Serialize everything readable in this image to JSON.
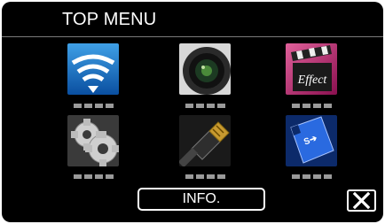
{
  "header": {
    "title": "TOP MENU"
  },
  "menu_items": [
    {
      "icon": "wifi-icon"
    },
    {
      "icon": "camera-lens-icon"
    },
    {
      "icon": "effect-icon"
    },
    {
      "icon": "gear-icon"
    },
    {
      "icon": "hdmi-cable-icon"
    },
    {
      "icon": "sd-card-icon"
    }
  ],
  "footer": {
    "info_label": "INFO.",
    "close_icon": "close-icon"
  },
  "colors": {
    "background": "#000000",
    "text": "#ffffff",
    "indicator": "#9a9a9a"
  }
}
